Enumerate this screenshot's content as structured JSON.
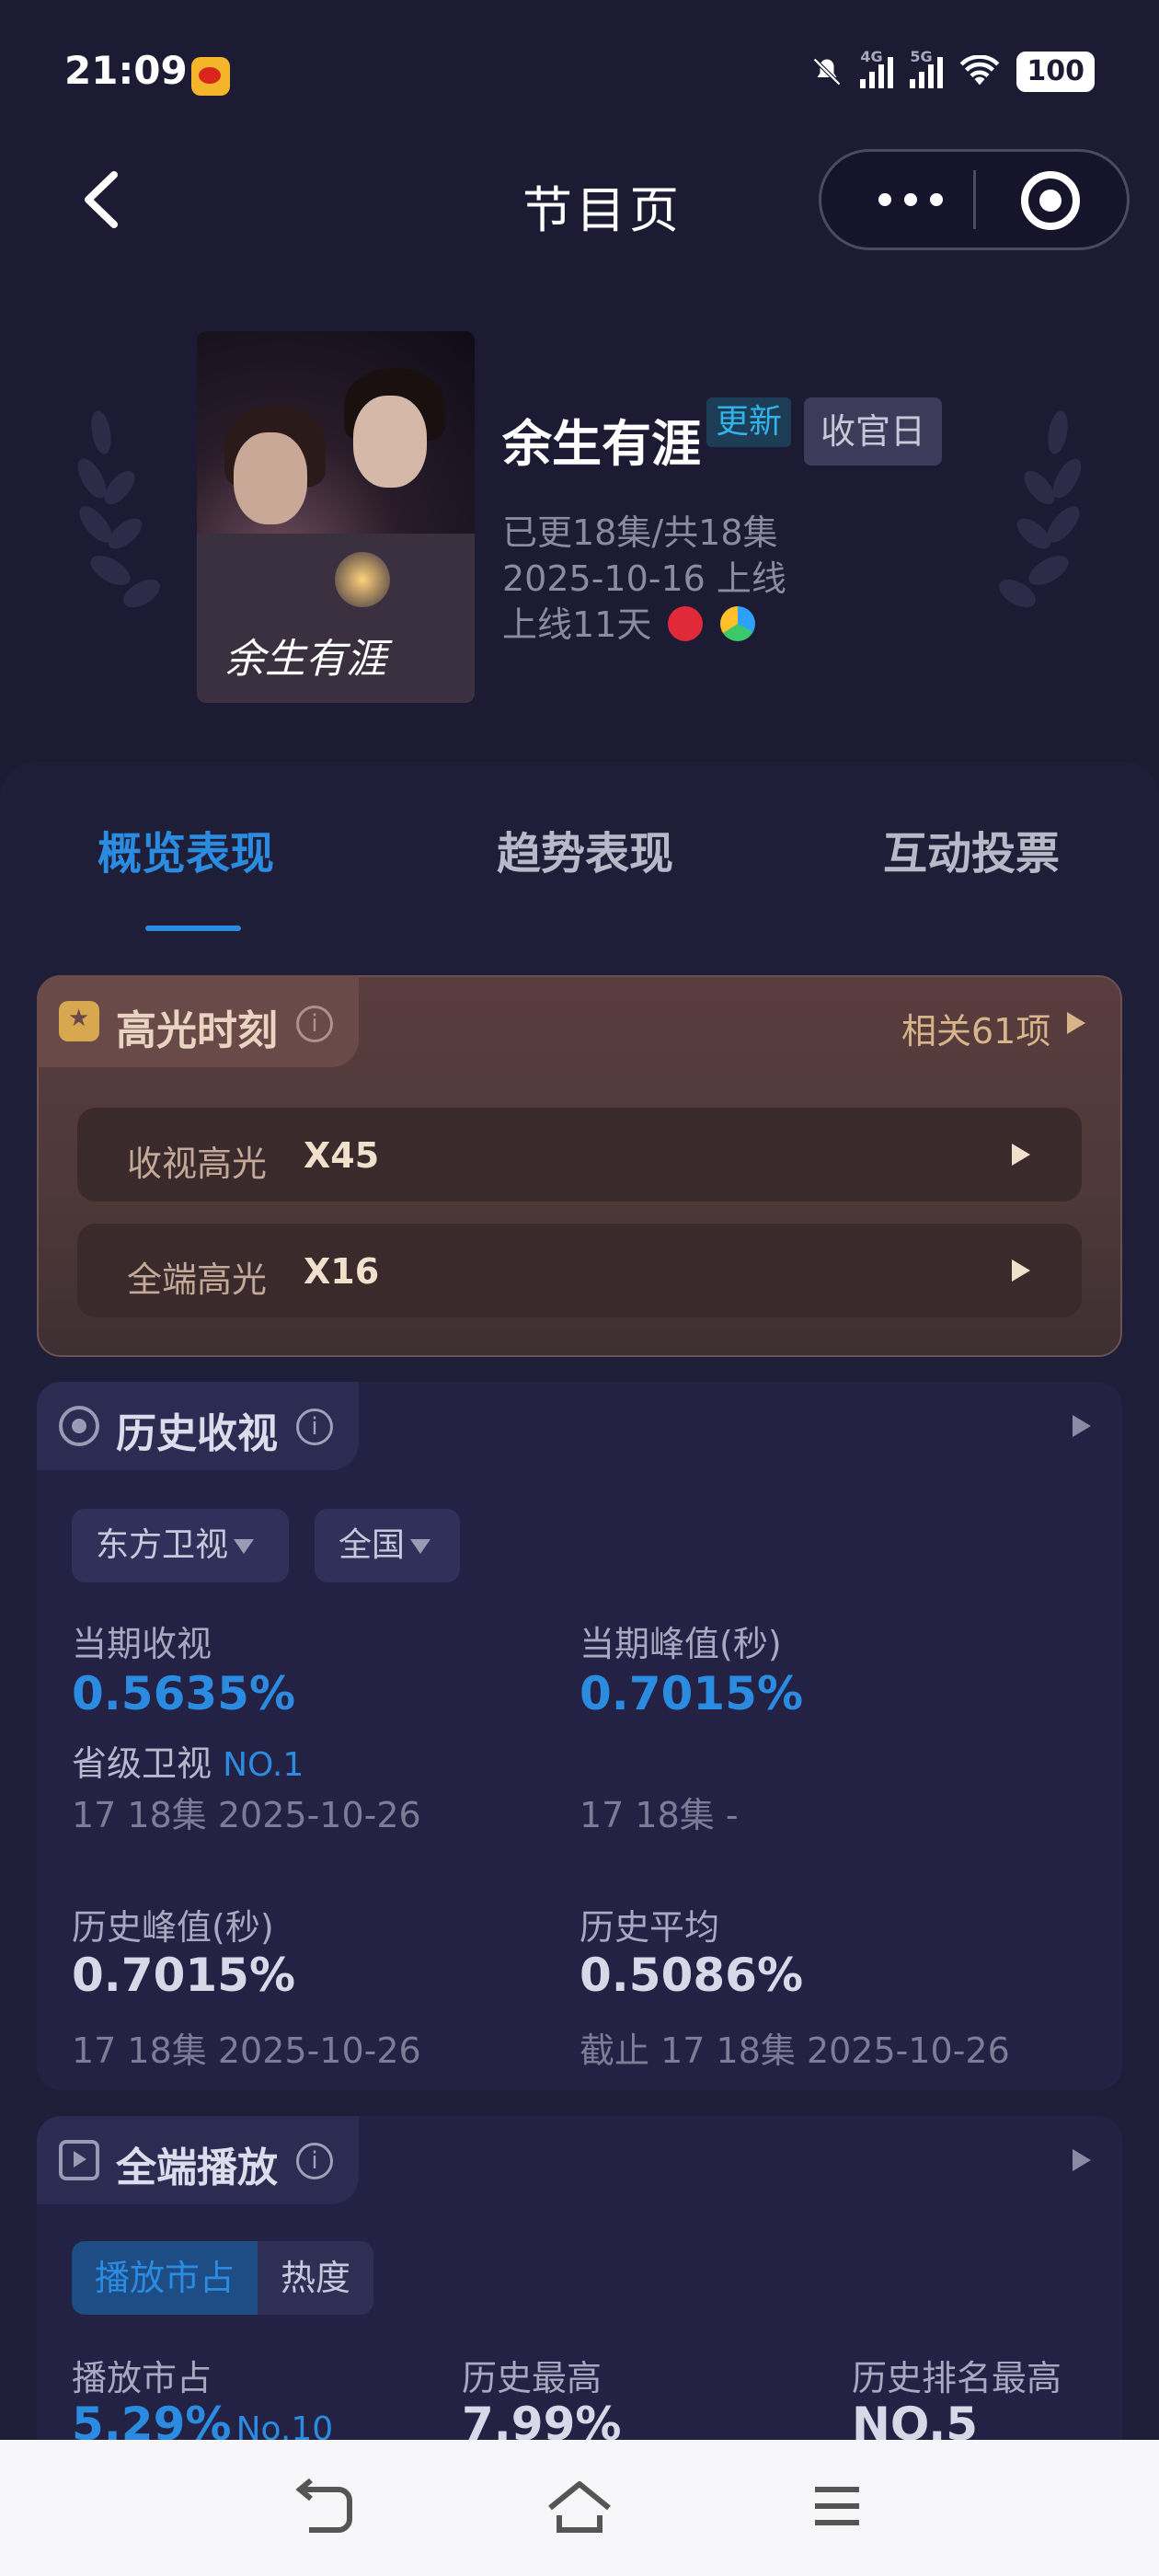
{
  "status_bar": {
    "time": "21:09",
    "app_icon": "weibo-icon",
    "network1": "4G",
    "network2": "5G",
    "battery": "100"
  },
  "nav": {
    "title": "节目页",
    "back_icon": "chevron-left-icon",
    "more_icon": "more-dots-icon",
    "target_icon": "target-icon"
  },
  "show": {
    "title": "余生有涯",
    "badge_update": "更新",
    "badge_final": "收官日",
    "episodes": "已更18集/共18集",
    "release": "2025-10-16 上线",
    "days": "上线11天",
    "poster_text": "余生有涯"
  },
  "tabs": [
    {
      "label": "概览表现",
      "active": true
    },
    {
      "label": "趋势表现",
      "active": false
    },
    {
      "label": "互动投票",
      "active": false
    }
  ],
  "highlights": {
    "title": "高光时刻",
    "related": "相关61项",
    "rows": [
      {
        "label": "收视高光",
        "value": "X45"
      },
      {
        "label": "全端高光",
        "value": "X16"
      }
    ]
  },
  "history": {
    "title": "历史收视",
    "dropdowns": [
      "东方卫视",
      "全国"
    ],
    "current_label": "当期收视",
    "current_value": "0.5635%",
    "rank_label": "省级卫视",
    "rank_value": "NO.1",
    "current_sub": "17 18集 2025-10-26",
    "peak_label": "当期峰值(秒)",
    "peak_value": "0.7015%",
    "peak_sub": "17 18集 -",
    "hist_peak_label": "历史峰值(秒)",
    "hist_peak_value": "0.7015%",
    "hist_peak_sub": "17 18集 2025-10-26",
    "hist_avg_label": "历史平均",
    "hist_avg_value": "0.5086%",
    "hist_avg_sub": "截止 17 18集 2025-10-26"
  },
  "playback": {
    "title": "全端播放",
    "segments": [
      "播放市占",
      "热度"
    ],
    "col1_label": "播放市占",
    "col1_value": "5.29%",
    "col1_rank": "No.10",
    "col2_label": "历史最高",
    "col2_value": "7.99%",
    "col3_label": "历史排名最高",
    "col3_value": "NO.5"
  },
  "system_nav": [
    "back-icon",
    "home-icon",
    "menu-icon"
  ]
}
